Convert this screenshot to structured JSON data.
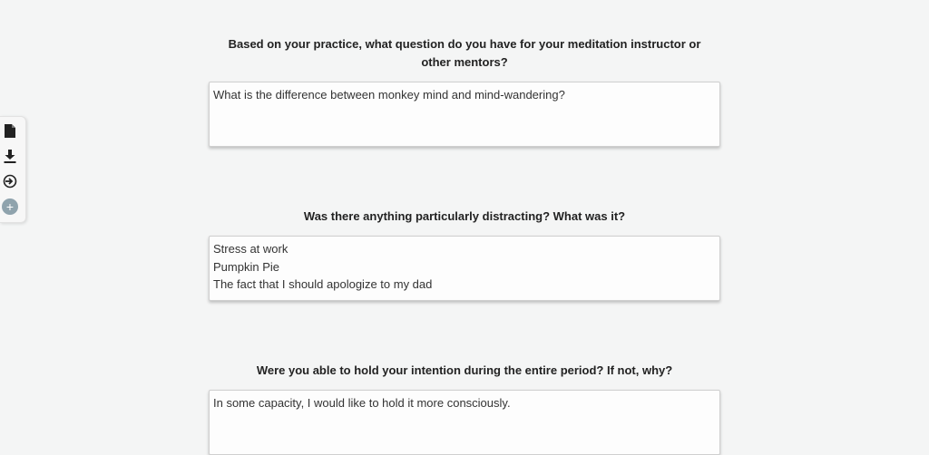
{
  "toolbar": {
    "tools": [
      {
        "icon": "document-icon"
      },
      {
        "icon": "download-icon"
      },
      {
        "icon": "import-icon"
      },
      {
        "icon": "plus-icon",
        "glyph": "+"
      }
    ]
  },
  "prompts": [
    {
      "question": "Based on your practice, what question do you have for your meditation instructor or other mentors?",
      "answer_lines": [
        "What is the difference between monkey mind and mind-wandering?"
      ]
    },
    {
      "question": "Was there anything particularly distracting? What was it?",
      "answer_lines": [
        "Stress at work",
        "Pumpkin Pie",
        "The fact that I should apologize to my dad"
      ]
    },
    {
      "question": "Were you able to hold your intention during the entire period? If not, why?",
      "answer_lines": [
        "In some capacity, I would like to hold it more consciously."
      ]
    }
  ],
  "colors": {
    "background": "#f4f5f5",
    "add_button": "#8fa3ad"
  }
}
